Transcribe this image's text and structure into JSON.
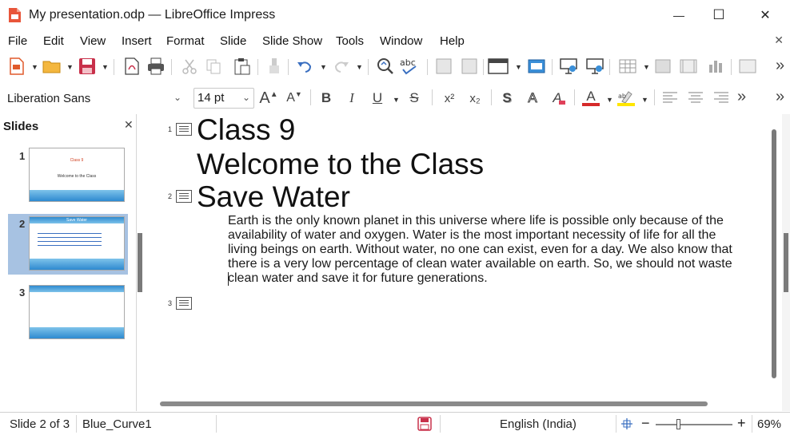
{
  "window": {
    "title": "My presentation.odp — LibreOffice Impress",
    "minimize_glyph": "—",
    "maximize_glyph": "☐",
    "close_glyph": "✕"
  },
  "menu": {
    "items": [
      "File",
      "Edit",
      "View",
      "Insert",
      "Format",
      "Slide",
      "Slide Show",
      "Tools",
      "Window",
      "Help"
    ],
    "close_glyph": "✕"
  },
  "format_toolbar": {
    "font_name": "Liberation Sans",
    "font_size": "14 pt",
    "grow_glyph": "A",
    "shrink_glyph": "A",
    "bold": "B",
    "italic": "I",
    "underline": "U",
    "strike": "S",
    "superscript": "x²",
    "subscript": "x₂",
    "shadow": "S",
    "outline": "A",
    "clear": "A",
    "font_color": "A",
    "more_glyph": "»",
    "font_color_hex": "#d62a2a",
    "highlight_color_hex": "#ffe600"
  },
  "slides_pane": {
    "title": "Slides",
    "close_glyph": "✕",
    "thumbnails": [
      {
        "number": "1",
        "title": "Class 9",
        "subtitle": "Welcome to the Class"
      },
      {
        "number": "2",
        "title": "Save Water",
        "subtitle": ""
      },
      {
        "number": "3",
        "title": "",
        "subtitle": ""
      }
    ]
  },
  "outline": {
    "slides": [
      {
        "number": "1",
        "title": "Class 9",
        "subtitle": "Welcome to the Class"
      },
      {
        "number": "2",
        "title": "Save Water",
        "body": "Earth is the only known planet in this universe where life is possible only because of the availability of water and oxygen. Water is the most important necessity of life for all the living beings on earth. Without water, no one can exist, even for a day. We also know that there is a very low percentage of clean water available on earth. So, we should not waste clean water and save it for future generations."
      },
      {
        "number": "3",
        "title": ""
      }
    ]
  },
  "status": {
    "slide_info": "Slide 2 of 3",
    "master": "Blue_Curve1",
    "language": "English (India)",
    "zoom": "69%",
    "zoom_minus": "−",
    "zoom_plus": "+"
  }
}
